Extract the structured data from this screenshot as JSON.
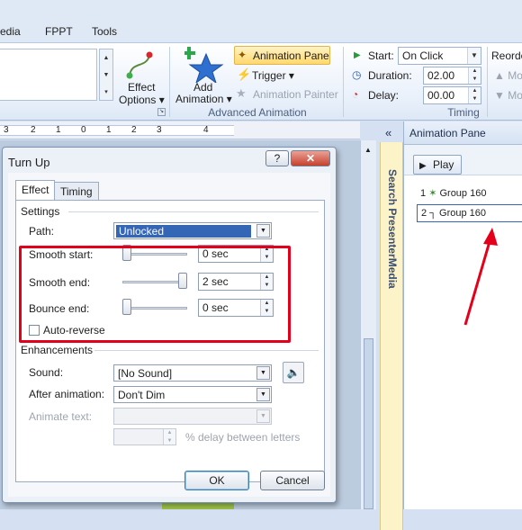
{
  "menu_tabs": [
    "edia",
    "FPPT",
    "Tools"
  ],
  "ribbon": {
    "effect_options_label": "Effect Options",
    "effect_options_line1": "Effect",
    "effect_options_line2": "Options ▾",
    "add_animation_line1": "Add",
    "add_animation_line2": "Animation ▾",
    "animation_pane": "Animation Pane",
    "trigger": "Trigger ▾",
    "animation_painter": "Animation Painter",
    "advanced_animation": "Advanced Animation",
    "start_label": "Start:",
    "start_value": "On Click",
    "duration_label": "Duration:",
    "duration_value": "02.00",
    "delay_label": "Delay:",
    "delay_value": "00.00",
    "timing": "Timing",
    "reorder": "Reorde",
    "move_earlier": "Mo",
    "move_later": "Mo"
  },
  "ruler": {
    "marks": [
      "3",
      "2",
      "1",
      "0",
      "1",
      "2",
      "3",
      "4"
    ]
  },
  "side_panel": {
    "search_label": "Search PresenterMedia",
    "collapse": "«"
  },
  "anim_pane": {
    "title": "Animation Pane",
    "play": "Play",
    "items": [
      {
        "num": "1",
        "label": "Group 160"
      },
      {
        "num": "2",
        "label": "Group 160"
      }
    ]
  },
  "dialog": {
    "title": "Turn Up",
    "help": "?",
    "close": "✕",
    "tabs": [
      "Effect",
      "Timing"
    ],
    "settings_label": "Settings",
    "path_label": "Path:",
    "path_value": "Unlocked",
    "smooth_start_label": "Smooth start:",
    "smooth_start_value": "0 sec",
    "smooth_start_fraction": 0.0,
    "smooth_end_label": "Smooth end:",
    "smooth_end_value": "2 sec",
    "smooth_end_fraction": 1.0,
    "bounce_end_label": "Bounce end:",
    "bounce_end_value": "0 sec",
    "bounce_end_fraction": 0.0,
    "auto_reverse_label": "Auto-reverse",
    "enhancements_label": "Enhancements",
    "sound_label": "Sound:",
    "sound_value": "[No Sound]",
    "after_animation_label": "After animation:",
    "after_animation_value": "Don't Dim",
    "animate_text_label": "Animate text:",
    "delay_between_label": "% delay between letters",
    "ok": "OK",
    "cancel": "Cancel"
  },
  "colors": {
    "highlight_red": "#e4001b",
    "accent_blue": "#3a5f9e",
    "selection_blue": "#3565b5"
  }
}
